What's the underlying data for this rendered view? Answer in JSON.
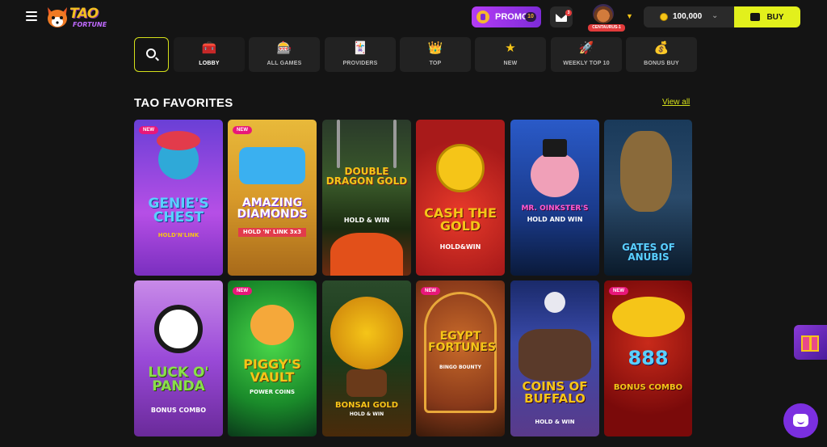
{
  "header": {
    "logo": {
      "main": "TAO",
      "sub": "FORTUNE"
    },
    "promo": {
      "label": "PROMO",
      "badge": "10",
      "icon": "promo-icon"
    },
    "mail": {
      "icon": "envelope-icon",
      "badge": "3"
    },
    "user": {
      "name": "CENTAURUS-1",
      "icon": "chevron-down-icon"
    },
    "balance": {
      "value": "100,000",
      "icon": "coin-icon"
    },
    "buy": {
      "label": "BUY",
      "icon": "wallet-icon"
    }
  },
  "nav": {
    "search_icon": "search-icon",
    "categories": [
      {
        "label": "LOBBY",
        "icon": "treasure-chest-icon",
        "active": true
      },
      {
        "label": "ALL GAMES",
        "icon": "slot-machine-icon",
        "active": false
      },
      {
        "label": "PROVIDERS",
        "icon": "star-card-icon",
        "active": false
      },
      {
        "label": "TOP",
        "icon": "crown-icon",
        "active": false
      },
      {
        "label": "NEW",
        "icon": "star-icon",
        "active": false
      },
      {
        "label": "WEEKLY TOP 10",
        "icon": "rocket-icon",
        "active": false
      },
      {
        "label": "BONUS BUY",
        "icon": "money-bag-icon",
        "active": false
      }
    ]
  },
  "section": {
    "title": "TAO FAVORITES",
    "view_all": "View all"
  },
  "games": [
    {
      "title": "GENIE'S CHEST",
      "subtitle": "HOLD'N'LINK",
      "badge": "NEW"
    },
    {
      "title": "AMAZING DIAMONDS",
      "subtitle": "HOLD 'N' LINK 3x3",
      "badge": "NEW"
    },
    {
      "title": "DOUBLE DRAGON GOLD",
      "subtitle": "HOLD & WIN",
      "badge": ""
    },
    {
      "title": "CASH THE GOLD",
      "subtitle": "HOLD&WIN",
      "badge": ""
    },
    {
      "title": "MR. OINKSTER'S",
      "subtitle": "HOLD AND WIN",
      "badge": ""
    },
    {
      "title": "GATES OF ANUBIS",
      "subtitle": "",
      "badge": ""
    },
    {
      "title": "LUCK O' PANDA",
      "subtitle": "BONUS COMBO",
      "badge": ""
    },
    {
      "title": "PIGGY'S VAULT",
      "subtitle": "POWER COINS",
      "badge": "NEW"
    },
    {
      "title": "BONSAI GOLD",
      "subtitle": "HOLD & WIN",
      "badge": ""
    },
    {
      "title": "EGYPT FORTUNES",
      "subtitle": "BINGO BOUNTY",
      "badge": "NEW"
    },
    {
      "title": "COINS OF BUFFALO",
      "subtitle": "HOLD & WIN",
      "badge": ""
    },
    {
      "title": "888",
      "subtitle": "BONUS COMBO",
      "badge": "NEW"
    }
  ],
  "floating": {
    "gift_icon": "gift-icon",
    "chat_icon": "chat-icon"
  },
  "colors": {
    "accent": "#e2f01c",
    "promo": "#b43cf5",
    "badge": "#e8177a",
    "chat": "#7b2fe0"
  }
}
